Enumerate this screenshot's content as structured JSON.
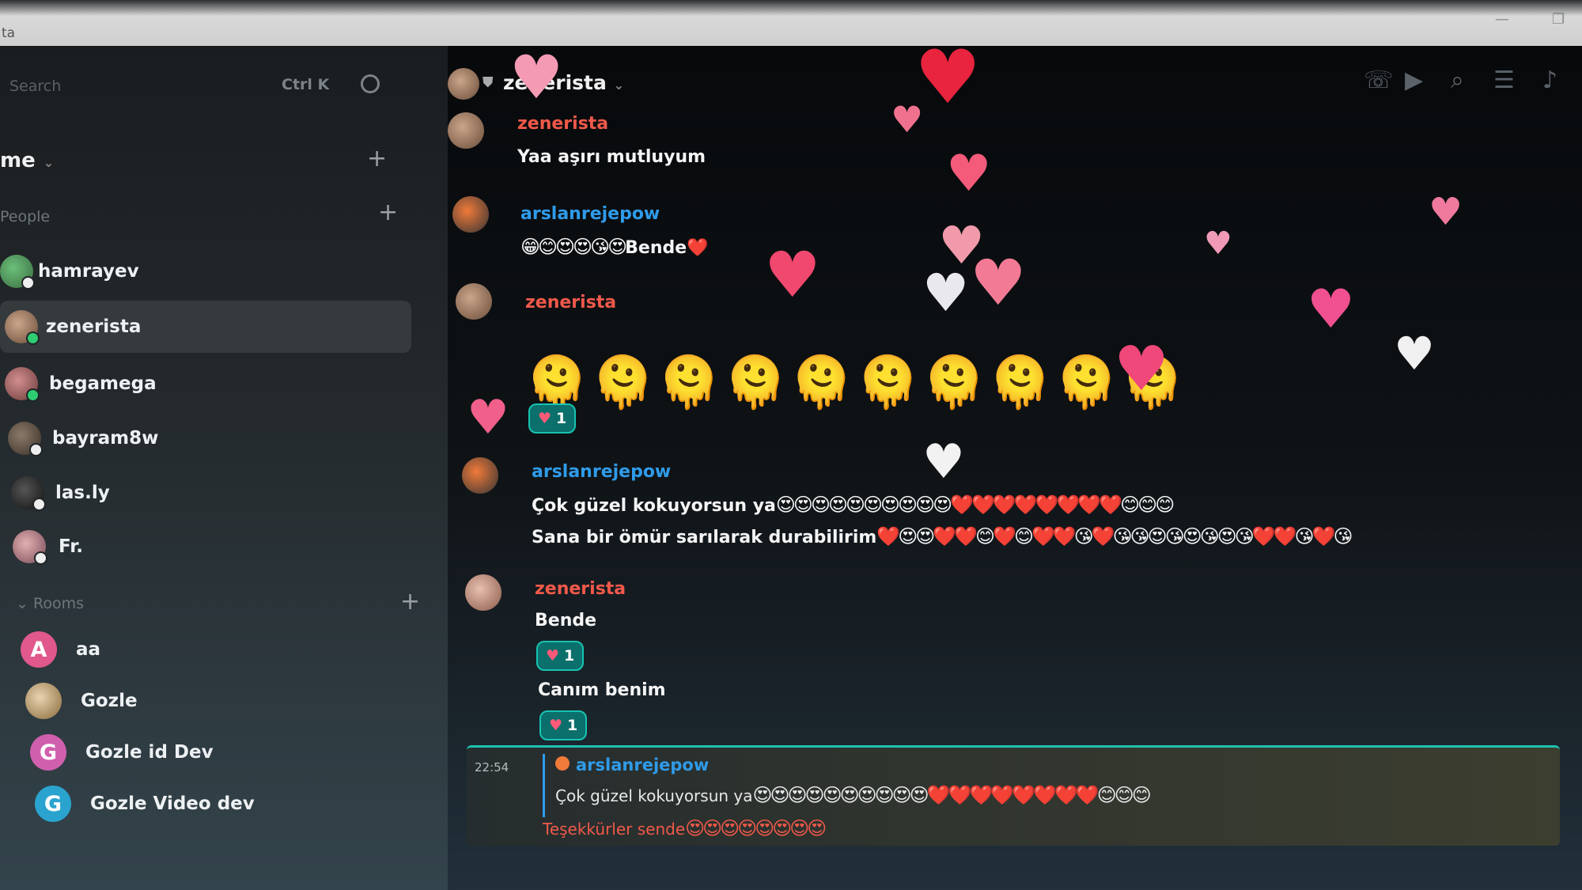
{
  "window": {
    "title": "ta"
  },
  "sidebar": {
    "search_placeholder": "Search",
    "search_shortcut": "Ctrl K",
    "space_name": "me",
    "people_title": "People",
    "people": [
      {
        "name": "hamrayev"
      },
      {
        "name": "zenerista"
      },
      {
        "name": "begamega"
      },
      {
        "name": "bayram8w"
      },
      {
        "name": "las.ly"
      },
      {
        "name": "Fr."
      }
    ],
    "rooms_title": "Rooms",
    "rooms": [
      {
        "initial": "A",
        "name": "aa"
      },
      {
        "initial": "",
        "name": "Gozle"
      },
      {
        "initial": "G",
        "name": "Gozle id Dev"
      },
      {
        "initial": "G",
        "name": "Gozle Video dev"
      }
    ]
  },
  "header": {
    "room_name": "zenerista"
  },
  "messages": [
    {
      "sender": "zenerista",
      "text": "Yaa aşırı mutluyum"
    },
    {
      "sender": "arslanrejepow",
      "emoji_prefix": "😁😊😍😍😘😍",
      "text": "Bende",
      "emoji_suffix": "❤️"
    },
    {
      "sender": "zenerista",
      "emoji": "🫠🫠🫠🫠🫠🫠🫠🫠🫠🫠",
      "reaction_count": "1"
    },
    {
      "sender": "arslanrejepow",
      "line1": "Çok güzel kokuyorsun ya",
      "line1_emoji": "😍😍😍😍😍😍😍😍😍😍❤️❤️❤️❤️❤️❤️❤️❤️😊😊😊",
      "line2": "Sana bir ömür sarılarak durabilirim",
      "line2_emoji": "❤️😍😍❤️❤️😊❤️😊❤️❤️😘❤️😘😘😍😘😍😘😍😘❤️❤️😘❤️😘"
    },
    {
      "sender": "zenerista",
      "text1": "Bende",
      "reaction1": "1",
      "text2": "Canım benim",
      "reaction2": "1"
    }
  ],
  "reply": {
    "time": "22:54",
    "quoted_sender": "arslanrejepow",
    "quoted_text": "Çok güzel kokuyorsun ya",
    "quoted_emoji": "😍😍😍😍😍😍😍😍😍😍❤️❤️❤️❤️❤️❤️❤️❤️😊😊😊",
    "text": "Teşekkürler sende",
    "text_emoji": "😍😍😍😍😍😍😍😍"
  },
  "colors": {
    "accent": "#17c3b2",
    "zenerista": "#f0594a",
    "arslanrejepow": "#2f9bea"
  }
}
